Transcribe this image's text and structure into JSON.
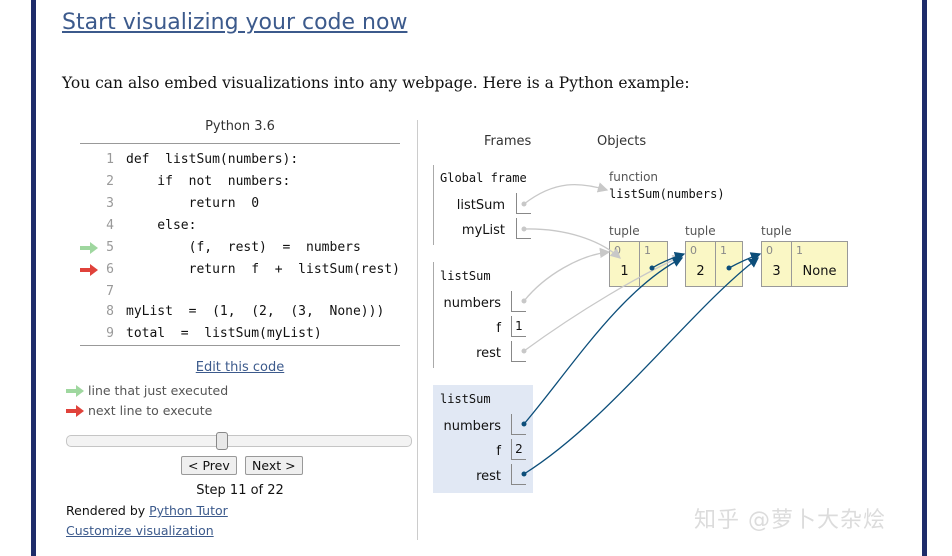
{
  "heading": "Start visualizing your code now",
  "intro": "You can also embed visualizations into any webpage. Here is a Python example:",
  "python_version": "Python 3.6",
  "code_lines": [
    {
      "no": "1",
      "text": "def  listSum(numbers):"
    },
    {
      "no": "2",
      "text": "    if  not  numbers:"
    },
    {
      "no": "3",
      "text": "        return  0"
    },
    {
      "no": "4",
      "text": "    else:"
    },
    {
      "no": "5",
      "text": "        (f,  rest)  =  numbers"
    },
    {
      "no": "6",
      "text": "        return  f  +  listSum(rest)"
    },
    {
      "no": "7",
      "text": ""
    },
    {
      "no": "8",
      "text": "myList  =  (1,  (2,  (3,  None)))"
    },
    {
      "no": "9",
      "text": "total  =  listSum(myList)"
    }
  ],
  "edit_link": "Edit this code",
  "legend": {
    "executed": "line that just executed",
    "next": "next line to execute",
    "executed_color": "#9fd79f",
    "next_color": "#e0423b"
  },
  "slider_level": 0.45,
  "nav": {
    "prev": "< Prev",
    "next": "Next >"
  },
  "step_text": "Step 11 of 22",
  "rendered_by": "Rendered by ",
  "rendered_link": "Python Tutor",
  "customize_link": "Customize visualization",
  "viz": {
    "frames_header": "Frames",
    "objects_header": "Objects",
    "global_frame": {
      "label": "Global frame",
      "vars": [
        {
          "name": "listSum"
        },
        {
          "name": "myList"
        }
      ]
    },
    "frame2": {
      "label": "listSum",
      "vars": [
        {
          "name": "numbers",
          "value": ""
        },
        {
          "name": "f",
          "value": "1"
        },
        {
          "name": "rest",
          "value": ""
        }
      ]
    },
    "frame3": {
      "label": "listSum",
      "vars": [
        {
          "name": "numbers",
          "value": ""
        },
        {
          "name": "f",
          "value": "2"
        },
        {
          "name": "rest",
          "value": ""
        }
      ]
    },
    "function_obj": {
      "label": "function",
      "signature": "listSum(numbers)"
    },
    "tuples": [
      {
        "label": "tuple",
        "idx": [
          "0",
          "1"
        ],
        "vals": [
          "1",
          ""
        ]
      },
      {
        "label": "tuple",
        "idx": [
          "0",
          "1"
        ],
        "vals": [
          "2",
          ""
        ]
      },
      {
        "label": "tuple",
        "idx": [
          "0",
          "1"
        ],
        "vals": [
          "3",
          "None"
        ]
      }
    ]
  },
  "watermark": "知乎 @萝卜大杂烩",
  "colors": {
    "accent": "#3c5a8c",
    "border": "#1e2c6a",
    "tuple_bg": "#faf7c5",
    "active_frame_bg": "#e1e8f4",
    "pointer_dark": "#0c4e7a",
    "pointer_light": "#c8c8c8"
  }
}
